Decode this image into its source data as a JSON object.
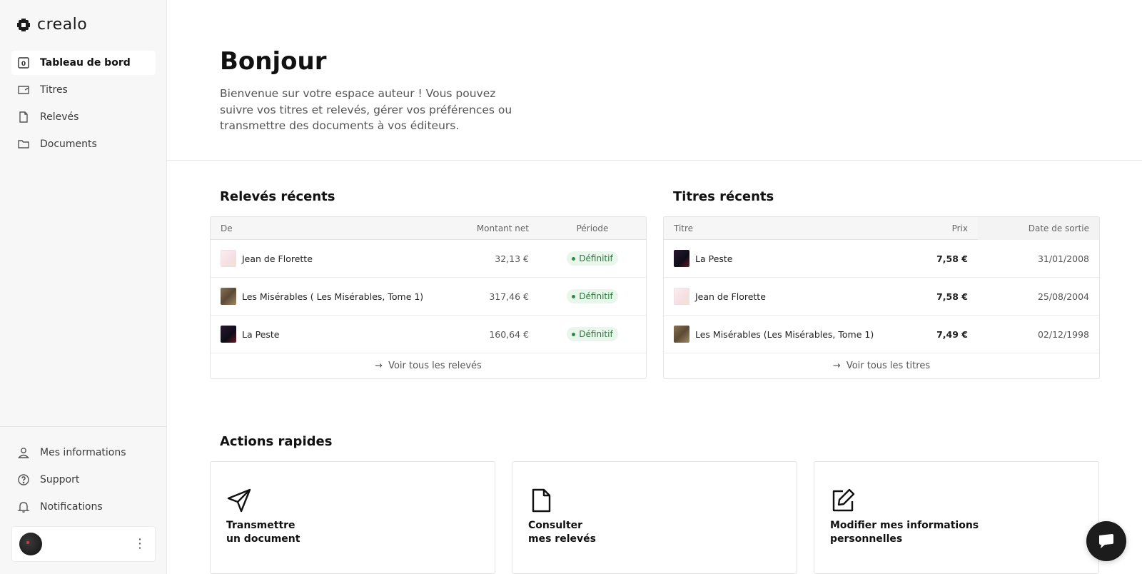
{
  "brand": {
    "name": "crealo"
  },
  "sidebar": {
    "items": [
      {
        "label": "Tableau de bord",
        "icon": "dashboard-icon",
        "active": true
      },
      {
        "label": "Titres",
        "icon": "book-icon",
        "active": false
      },
      {
        "label": "Relevés",
        "icon": "file-icon",
        "active": false
      },
      {
        "label": "Documents",
        "icon": "folder-icon",
        "active": false
      }
    ],
    "bottom_items": [
      {
        "label": "Mes informations",
        "icon": "user-icon"
      },
      {
        "label": "Support",
        "icon": "help-circle-icon"
      },
      {
        "label": "Notifications",
        "icon": "bell-icon"
      }
    ],
    "user_menu_icon": "kebab-menu-icon"
  },
  "hero": {
    "title": "Bonjour",
    "subtitle": "Bienvenue sur votre espace auteur ! Vous pouvez suivre vos titres et relevés, gérer vos préférences ou transmettre des documents à vos éditeurs."
  },
  "releves": {
    "title": "Relevés récents",
    "headers": {
      "from": "De",
      "amount": "Montant net",
      "period": "Période"
    },
    "rows": [
      {
        "title": "Jean de Florette",
        "amount": "32,13 €",
        "status": "Définitif",
        "cover": "florette"
      },
      {
        "title": "Les Misérables ( Les Misérables, Tome 1)",
        "amount": "317,46 €",
        "status": "Définitif",
        "cover": "miserables"
      },
      {
        "title": "La Peste",
        "amount": "160,64 €",
        "status": "Définitif",
        "cover": "peste"
      }
    ],
    "footer_link": "Voir tous les relevés"
  },
  "titres": {
    "title": "Titres récents",
    "headers": {
      "title": "Titre",
      "price": "Prix",
      "date": "Date de sortie"
    },
    "rows": [
      {
        "title": "La Peste",
        "price": "7,58 €",
        "date": "31/01/2008",
        "cover": "peste"
      },
      {
        "title": "Jean de Florette",
        "price": "7,58 €",
        "date": "25/08/2004",
        "cover": "florette"
      },
      {
        "title": "Les Misérables (Les Misérables, Tome 1)",
        "price": "7,49 €",
        "date": "02/12/1998",
        "cover": "miserables"
      }
    ],
    "footer_link": "Voir tous les titres"
  },
  "actions": {
    "title": "Actions rapides",
    "cards": [
      {
        "line1": "Transmettre",
        "line2": "un document",
        "icon": "send-icon"
      },
      {
        "line1": "Consulter",
        "line2": "mes relevés",
        "icon": "document-icon"
      },
      {
        "line1": "Modifier mes informations",
        "line2": "personnelles",
        "icon": "edit-icon"
      }
    ]
  },
  "chat": {
    "icon": "chat-icon"
  },
  "colors": {
    "accent_success": "#2a7a3b",
    "sidebar_bg": "#f7f7f7"
  }
}
